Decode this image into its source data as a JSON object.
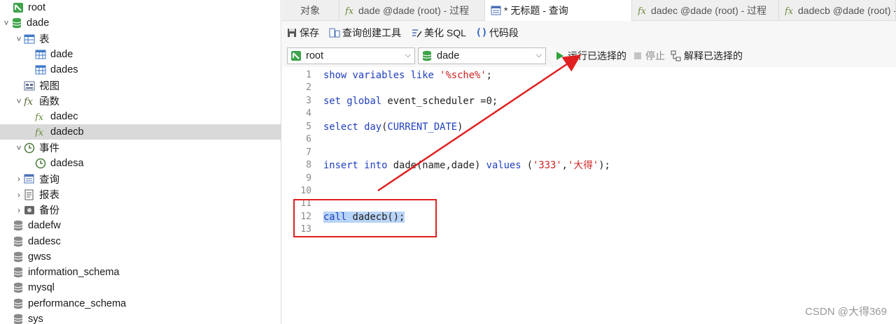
{
  "sidebar": {
    "items": [
      {
        "label": "root",
        "icon": "connection-icon",
        "chev": ""
      },
      {
        "label": "dade",
        "icon": "database-icon",
        "chev": "˅"
      },
      {
        "label": "表",
        "icon": "table-group-icon",
        "chev": "˅"
      },
      {
        "label": "dade",
        "icon": "table-icon",
        "chev": ""
      },
      {
        "label": "dades",
        "icon": "table-icon",
        "chev": ""
      },
      {
        "label": "视图",
        "icon": "view-icon",
        "chev": ""
      },
      {
        "label": "函数",
        "icon": "function-group-icon",
        "chev": "˅"
      },
      {
        "label": "dadec",
        "icon": "function-icon",
        "chev": ""
      },
      {
        "label": "dadecb",
        "icon": "function-icon",
        "chev": "",
        "selected": true
      },
      {
        "label": "事件",
        "icon": "event-group-icon",
        "chev": "˅"
      },
      {
        "label": "dadesa",
        "icon": "event-icon",
        "chev": ""
      },
      {
        "label": "查询",
        "icon": "query-icon",
        "chev": "›"
      },
      {
        "label": "报表",
        "icon": "report-icon",
        "chev": "›"
      },
      {
        "label": "备份",
        "icon": "backup-icon",
        "chev": "›"
      },
      {
        "label": "dadefw",
        "icon": "database-gray-icon",
        "chev": ""
      },
      {
        "label": "dadesc",
        "icon": "database-gray-icon",
        "chev": ""
      },
      {
        "label": "gwss",
        "icon": "database-gray-icon",
        "chev": ""
      },
      {
        "label": "information_schema",
        "icon": "database-gray-icon",
        "chev": ""
      },
      {
        "label": "mysql",
        "icon": "database-gray-icon",
        "chev": ""
      },
      {
        "label": "performance_schema",
        "icon": "database-gray-icon",
        "chev": ""
      },
      {
        "label": "sys",
        "icon": "database-gray-icon",
        "chev": ""
      }
    ]
  },
  "tabs": [
    {
      "label": "对象",
      "icon": ""
    },
    {
      "label": "dade @dade (root) - 过程",
      "icon": "function-icon"
    },
    {
      "label": "* 无标题 - 查询",
      "icon": "query-icon",
      "active": true
    },
    {
      "label": "dadec @dade (root) - 过程",
      "icon": "function-icon"
    },
    {
      "label": "dadecb @dade (root) - 过程",
      "icon": "function-icon"
    }
  ],
  "toolbar": {
    "save": "保存",
    "query_builder": "查询创建工具",
    "beautify": "美化 SQL",
    "snippet": "代码段"
  },
  "connbar": {
    "connection": "root",
    "database": "dade",
    "run_selected": "运行已选择的",
    "stop": "停止",
    "explain_selected": "解释已选择的"
  },
  "editor": {
    "line_numbers": [
      "1",
      "2",
      "3",
      "4",
      "5",
      "6",
      "7",
      "8",
      "9",
      "10",
      "11",
      "12",
      "13"
    ],
    "lines": [
      "show variables like '%sche%';",
      "",
      "set global event_scheduler =0;",
      "",
      "select day(CURRENT_DATE)",
      "",
      "",
      "insert into dade(name,dade) values ('333','大得');",
      "",
      "",
      "",
      "call dadecb();",
      ""
    ],
    "highlighted_line": 12
  },
  "watermark": "CSDN @大得369",
  "colors": {
    "keyword": "#1e3fbf",
    "string": "#d02020",
    "annotation": "#e02020",
    "selection": "#b8d4f6"
  }
}
